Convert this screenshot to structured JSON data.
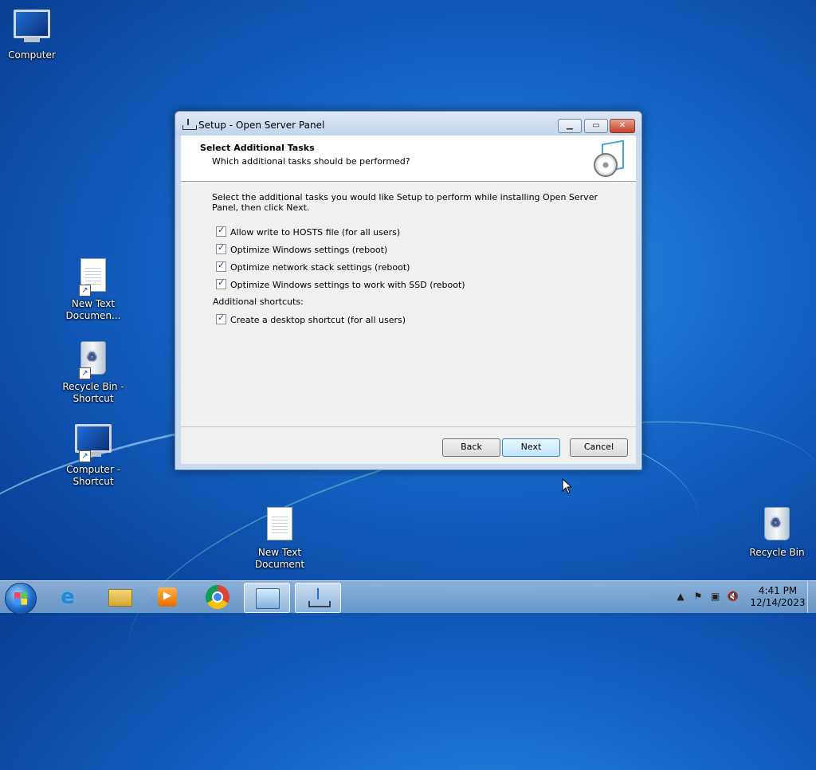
{
  "desktop": {
    "icons": [
      {
        "label": "Computer"
      },
      {
        "label": "New Text Documen..."
      },
      {
        "label": "Recycle Bin - Shortcut"
      },
      {
        "label": "Computer - Shortcut"
      },
      {
        "label": "New Text Document"
      },
      {
        "label": "Recycle Bin"
      }
    ]
  },
  "window": {
    "title": "Setup - Open Server Panel",
    "header_title": "Select Additional Tasks",
    "header_subtitle": "Which additional tasks should be performed?",
    "instructions": "Select the additional tasks you would like Setup to perform while installing Open Server Panel, then click Next.",
    "tasks": [
      {
        "label": "Allow write to HOSTS file (for all users)",
        "checked": true
      },
      {
        "label": "Optimize Windows settings (reboot)",
        "checked": true
      },
      {
        "label": "Optimize network stack settings (reboot)",
        "checked": true
      },
      {
        "label": "Optimize Windows settings to work with SSD (reboot)",
        "checked": true
      }
    ],
    "section_label": "Additional shortcuts:",
    "shortcut_task": {
      "label": "Create a desktop shortcut (for all users)",
      "checked": true
    },
    "buttons": {
      "back": "Back",
      "next": "Next",
      "cancel": "Cancel"
    }
  },
  "taskbar": {
    "clock_time": "4:41 PM",
    "clock_date": "12/14/2023"
  }
}
